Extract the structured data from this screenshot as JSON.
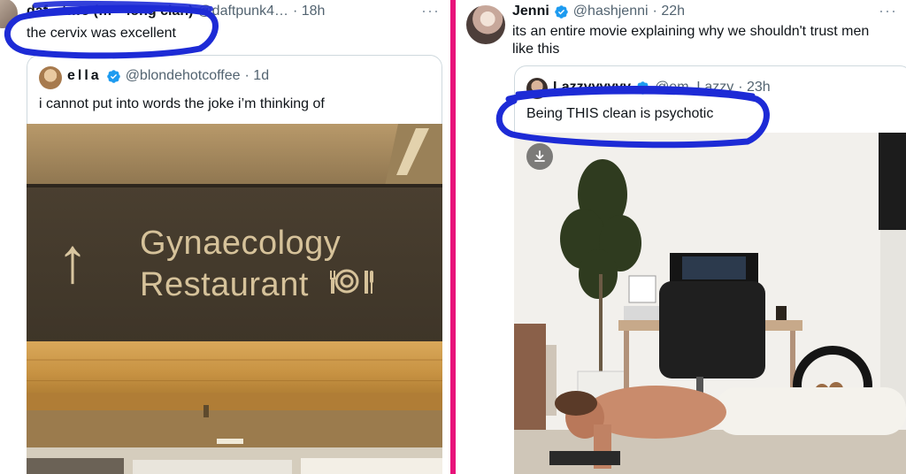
{
  "colors": {
    "divider": "#e8137a",
    "scribble": "#1d2bd6",
    "verified": "#1d9bf0"
  },
  "left_tweet": {
    "display_name": "daf…t…o (…—long clan)",
    "handle": "@daftpunk4…",
    "time": "· 18h",
    "more_icon": "more-horizontal-icon",
    "text": "the cervix was excellent",
    "quote": {
      "display_name": "ella",
      "handle": "@blondehotcoffee",
      "time": "· 1d",
      "text": "i cannot put into words the joke i’m thinking of",
      "sign": {
        "arrow": "↑",
        "line1": "Gynaecology",
        "line2": "Restaurant",
        "icon": "restaurant-icon"
      }
    }
  },
  "right_tweet": {
    "display_name": "Jenni",
    "handle": "@hashjenni",
    "time": "· 22h",
    "more_icon": "more-horizontal-icon",
    "text": "its an entire movie explaining why we shouldn't trust men like this",
    "quote": {
      "display_name": "Lazzyyyyyy",
      "handle": "@em_Lazzy",
      "time": "· 23h",
      "text": "Being THIS clean is psychotic",
      "download_icon": "download-icon"
    }
  }
}
